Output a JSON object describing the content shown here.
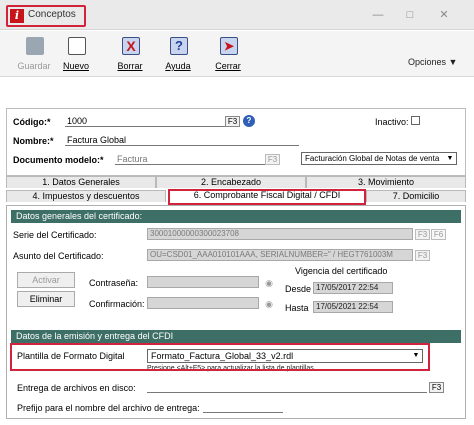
{
  "window": {
    "title": "Conceptos"
  },
  "toolbar": {
    "guardar": "Guardar",
    "nuevo": "Nuevo",
    "borrar": "Borrar",
    "ayuda": "Ayuda",
    "cerrar": "Cerrar",
    "opciones": "Opciones"
  },
  "form": {
    "codigo_label": "Código:*",
    "codigo_value": "1000",
    "nombre_label": "Nombre:*",
    "nombre_value": "Factura Global",
    "docmodelo_label": "Documento modelo:*",
    "docmodelo_value": "Factura",
    "inactivo_label": "Inactivo:",
    "docmodelo_select": "Facturación Global de Notas de venta",
    "f3": "F3"
  },
  "tabs": {
    "row1": [
      "1. Datos Generales",
      "2. Encabezado",
      "3. Movimiento"
    ],
    "row2": [
      "4. Impuestos y descuentos",
      "6. Comprobante Fiscal Digital / CFDI",
      "7. Domicilio"
    ]
  },
  "cert": {
    "heading": "Datos generales del certificado:",
    "serie_label": "Serie del Certificado:",
    "serie_value": "30001000000300023708",
    "asunto_label": "Asunto del Certificado:",
    "asunto_value": "OU=CSD01_AAA010101AAA, SERIALNUMBER=\" / HEGT761003M",
    "activar": "Activar",
    "eliminar": "Eliminar",
    "password_label": "Contraseña:",
    "confirm_label": "Confirmación:",
    "vigencia_label": "Vigencia del certificado",
    "desde_label": "Desde",
    "desde_value": "17/05/2017 22:54",
    "hasta_label": "Hasta",
    "hasta_value": "17/05/2021 22:54"
  },
  "emision": {
    "heading": "Datos de la emisión y entrega del CFDI",
    "plantilla_label": "Plantilla de Formato Digital",
    "plantilla_value": "Formato_Factura_Global_33_v2.rdl",
    "note": "Presione <Alt+F5> para actualizar la lista de plantillas",
    "entrega_label": "Entrega de archivos en disco:",
    "prefijo_label": "Prefijo para el nombre del archivo de entrega:"
  },
  "colors": {
    "accent_red": "#d2233c",
    "section_green": "#3e6f67"
  }
}
